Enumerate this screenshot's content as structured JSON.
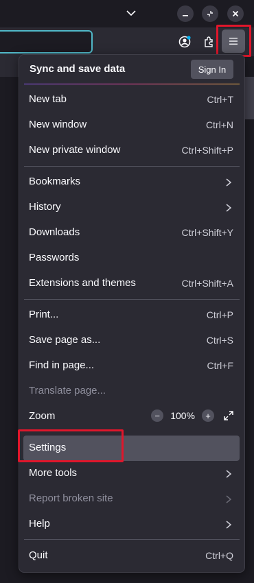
{
  "icons": {
    "chevron": "chevron-down-icon",
    "minimize": "minimize-icon",
    "restore": "restore-icon",
    "close": "close-icon",
    "account": "account-icon",
    "extensions": "extensions-icon",
    "menu": "hamburger-menu-icon"
  },
  "colors": {
    "highlight": "#e0162b",
    "url_focus": "#51b9c9"
  },
  "menu": {
    "sync_title": "Sync and save data",
    "sign_in": "Sign In",
    "items": [
      {
        "label": "New tab",
        "shortcut": "Ctrl+T"
      },
      {
        "label": "New window",
        "shortcut": "Ctrl+N"
      },
      {
        "label": "New private window",
        "shortcut": "Ctrl+Shift+P"
      },
      {
        "label": "Bookmarks",
        "shortcut": ""
      },
      {
        "label": "History",
        "shortcut": ""
      },
      {
        "label": "Downloads",
        "shortcut": "Ctrl+Shift+Y"
      },
      {
        "label": "Passwords",
        "shortcut": ""
      },
      {
        "label": "Extensions and themes",
        "shortcut": "Ctrl+Shift+A"
      },
      {
        "label": "Print...",
        "shortcut": "Ctrl+P"
      },
      {
        "label": "Save page as...",
        "shortcut": "Ctrl+S"
      },
      {
        "label": "Find in page...",
        "shortcut": "Ctrl+F"
      },
      {
        "label": "Translate page...",
        "shortcut": ""
      },
      {
        "label": "Zoom",
        "shortcut": ""
      },
      {
        "label": "Settings",
        "shortcut": ""
      },
      {
        "label": "More tools",
        "shortcut": ""
      },
      {
        "label": "Report broken site",
        "shortcut": ""
      },
      {
        "label": "Help",
        "shortcut": ""
      },
      {
        "label": "Quit",
        "shortcut": "Ctrl+Q"
      }
    ],
    "zoom": {
      "minus": "−",
      "value": "100%",
      "plus": "+"
    }
  }
}
